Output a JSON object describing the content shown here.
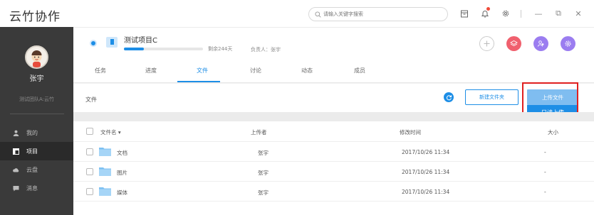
{
  "app": {
    "title": "云竹协作"
  },
  "search": {
    "placeholder": "请输入关键字搜索"
  },
  "window": {
    "minimize": "—",
    "restore": "⧉",
    "close": "✕"
  },
  "user": {
    "name": "张宇",
    "team": "测试团队A:云竹"
  },
  "sidebar": {
    "items": [
      {
        "label": "我的",
        "icon": "person-icon",
        "active": false
      },
      {
        "label": "项目",
        "icon": "project-icon",
        "active": true
      },
      {
        "label": "云盘",
        "icon": "cloud-icon",
        "active": false
      },
      {
        "label": "消息",
        "icon": "message-icon",
        "active": false
      }
    ]
  },
  "project": {
    "name": "测试项目C",
    "remaining": "剩余244天",
    "owner": "负责人：张宇",
    "progress": 0.25
  },
  "tabs": [
    {
      "label": "任务",
      "active": false
    },
    {
      "label": "进度",
      "active": false
    },
    {
      "label": "文件",
      "active": true
    },
    {
      "label": "讨论",
      "active": false
    },
    {
      "label": "动态",
      "active": false
    },
    {
      "label": "成员",
      "active": false
    }
  ],
  "toolbar": {
    "breadcrumb": "文件",
    "new_folder": "新建文件夹",
    "upload": "上传文件",
    "readonly_upload": "只读上传"
  },
  "table": {
    "headers": {
      "name": "文件名 ▾",
      "uploader": "上传者",
      "modified": "修改时间",
      "size": "大小"
    },
    "rows": [
      {
        "name": "文档",
        "uploader": "张宇",
        "modified": "2017/10/26 11:34",
        "size": "-"
      },
      {
        "name": "图片",
        "uploader": "张宇",
        "modified": "2017/10/26 11:34",
        "size": "-"
      },
      {
        "name": "媒体",
        "uploader": "张宇",
        "modified": "2017/10/26 11:34",
        "size": "-"
      }
    ]
  },
  "colors": {
    "accent": "#1d8ee6",
    "sidebar_bg": "#3a3a3a",
    "highlight_box": "#e02020"
  }
}
